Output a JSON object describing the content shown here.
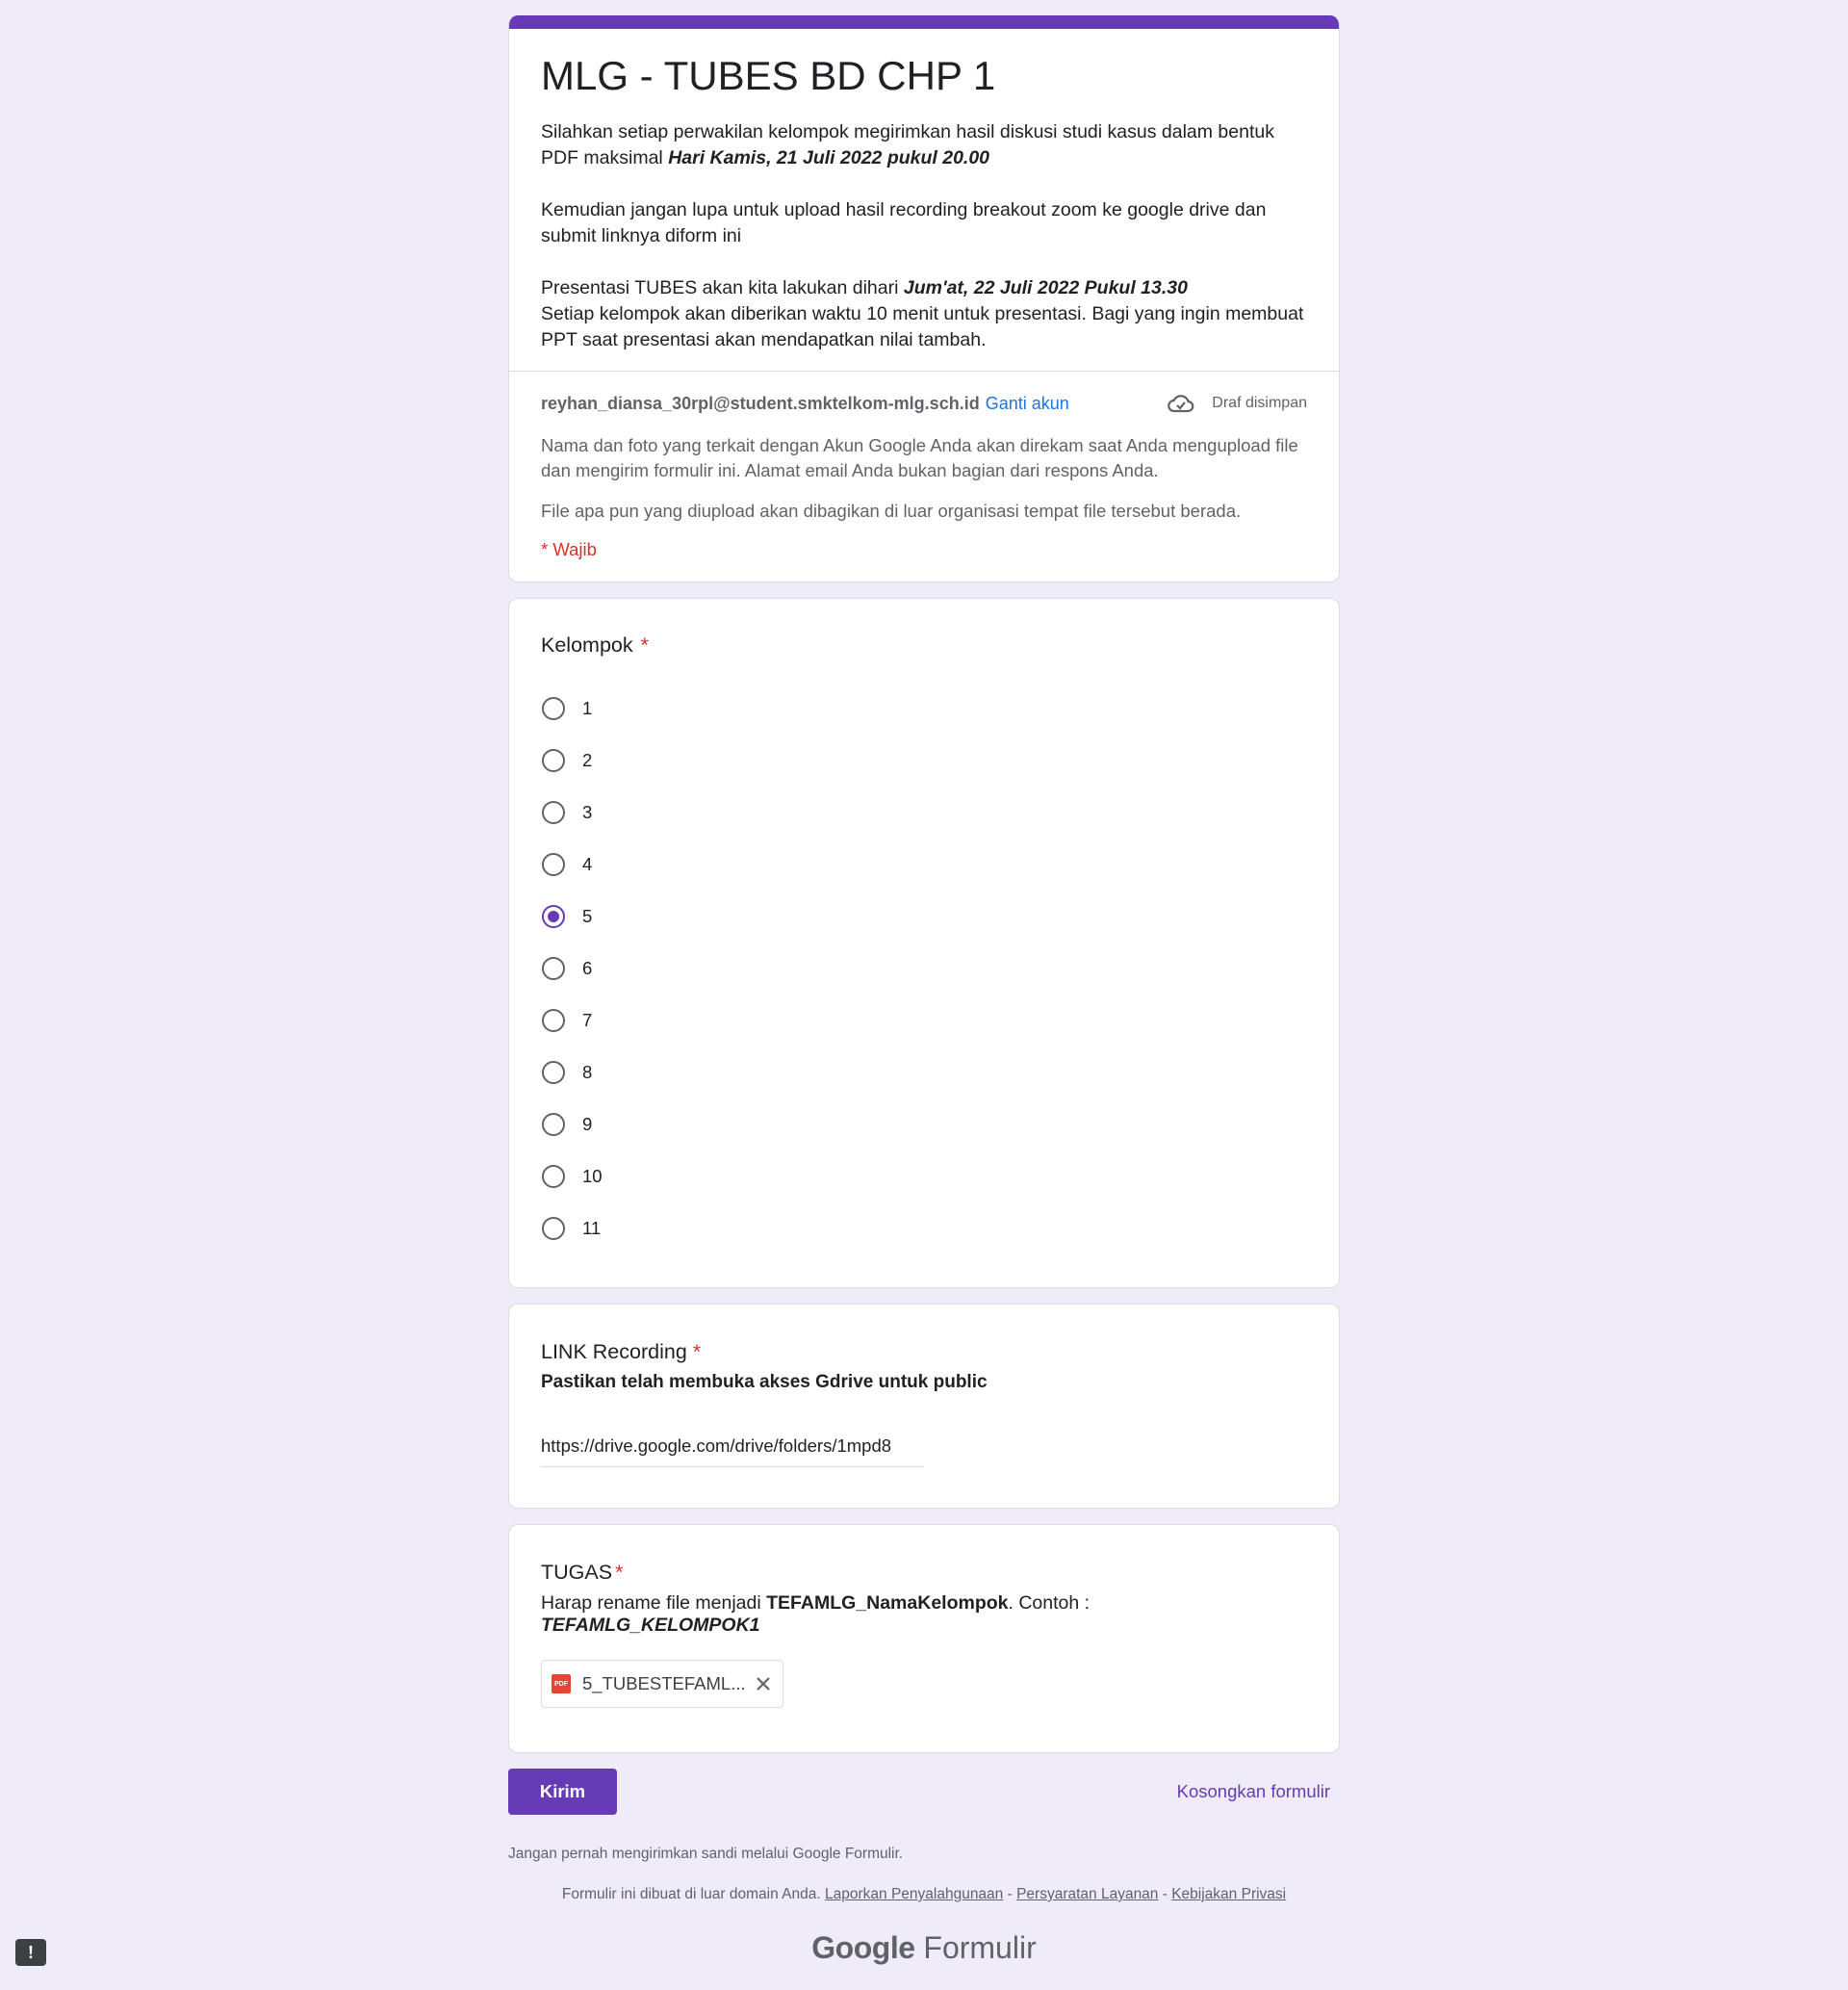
{
  "form": {
    "title": "MLG - TUBES BD CHP 1",
    "description": {
      "p1_text": "Silahkan setiap perwakilan kelompok megirimkan hasil diskusi studi kasus dalam bentuk PDF maksimal ",
      "p1_emph": "Hari Kamis, 21 Juli 2022 pukul 20.00",
      "p2_text": "Kemudian jangan lupa untuk upload hasil recording breakout zoom ke google drive dan submit linknya diform ini",
      "p3_text": "Presentasi TUBES akan kita lakukan dihari ",
      "p3_emph": "Jum'at, 22 Juli 2022 Pukul 13.30",
      "p3_text2": "Setiap kelompok akan diberikan waktu 10 menit untuk presentasi. Bagi yang ingin membuat PPT saat presentasi akan mendapatkan nilai tambah."
    }
  },
  "account": {
    "email": "reyhan_diansa_30rpl@student.smktelkom-mlg.sch.id",
    "switch_label": "Ganti akun",
    "draft_status": "Draf disimpan",
    "note1": "Nama dan foto yang terkait dengan Akun Google Anda akan direkam saat Anda mengupload file dan mengirim formulir ini. Alamat email Anda bukan bagian dari respons Anda.",
    "note2": "File apa pun yang diupload akan dibagikan di luar organisasi tempat file tersebut berada.",
    "required_note": "* Wajib"
  },
  "questions": {
    "kelompok": {
      "title": "Kelompok",
      "required_mark": "*",
      "options": [
        "1",
        "2",
        "3",
        "4",
        "5",
        "6",
        "7",
        "8",
        "9",
        "10",
        "11"
      ],
      "selected": "5"
    },
    "link": {
      "title": "LINK Recording",
      "required_mark": "*",
      "help": "Pastikan telah membuka akses Gdrive untuk public",
      "value": "https://drive.google.com/drive/folders/1mpd8"
    },
    "tugas": {
      "title": "TUGAS",
      "required_mark": "*",
      "help_prefix": "Harap rename file menjadi ",
      "help_bold": "TEFAMLG_NamaKelompok",
      "help_mid": ". Contoh : ",
      "help_example": "TEFAMLG_KELOMPOK1",
      "file_name": "5_TUBESTEFAML...",
      "file_badge": "PDF"
    }
  },
  "actions": {
    "submit": "Kirim",
    "clear": "Kosongkan formulir"
  },
  "footer": {
    "password_note": "Jangan pernah mengirimkan sandi melalui Google Formulir.",
    "domain_note": "Formulir ini dibuat di luar domain Anda.",
    "link_abuse": "Laporkan Penyalahgunaan",
    "link_terms": "Persyaratan Layanan",
    "link_privacy": "Kebijakan Privasi",
    "sep": " - ",
    "brand_google": "Google",
    "brand_product": "Formulir"
  },
  "icons": {
    "cloud": "cloud-check-icon",
    "close": "close-icon",
    "report": "report-icon"
  },
  "colors": {
    "accent": "#673ab7",
    "background": "#efebf8",
    "required": "#d93025",
    "link": "#1a73e8"
  }
}
